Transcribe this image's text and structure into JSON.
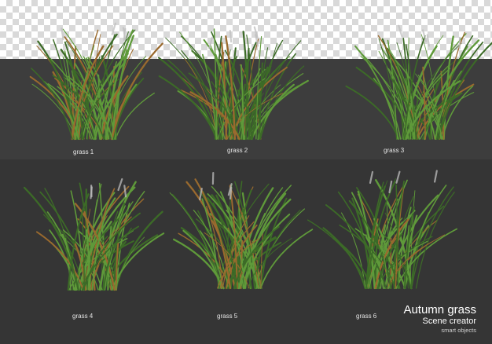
{
  "items": [
    {
      "label": "grass 1"
    },
    {
      "label": "grass 2"
    },
    {
      "label": "grass 3"
    },
    {
      "label": "grass 4"
    },
    {
      "label": "grass 5"
    },
    {
      "label": "grass 6"
    }
  ],
  "branding": {
    "title": "Autumn grass",
    "subtitle": "Scene creator",
    "note": "smart objects"
  },
  "colors": {
    "checker_light": "#ffffff",
    "checker_dark": "#d9d9d9",
    "band_upper": "#3d3d3d",
    "band_lower": "#353535",
    "grass_green": "#5f9a3a",
    "grass_dark": "#3c6b27",
    "grass_autumn": "#9a6a2e",
    "seed_head": "#bfbfbf"
  }
}
